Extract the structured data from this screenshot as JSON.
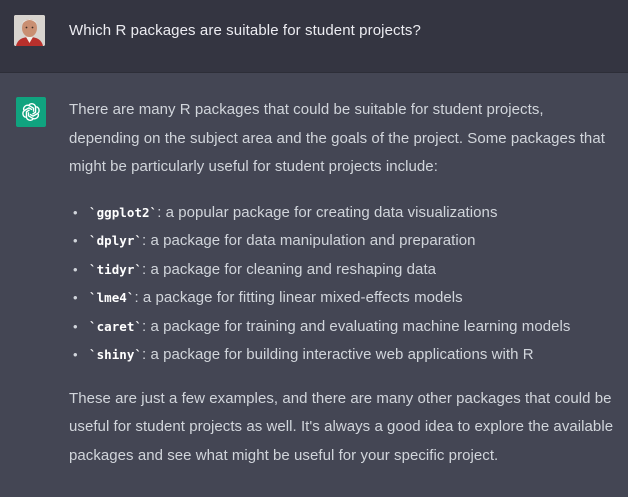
{
  "user_message": {
    "text": "Which R packages are suitable for student projects?"
  },
  "assistant_message": {
    "intro": "There are many R packages that could be suitable for student projects, depending on the subject area and the goals of the project. Some packages that might be particularly useful for student projects include:",
    "packages": [
      {
        "bullet": "•",
        "name": "`ggplot2`",
        "description": ": a popular package for creating data visualizations"
      },
      {
        "bullet": "•",
        "name": "`dplyr`",
        "description": ": a package for data manipulation and preparation"
      },
      {
        "bullet": "•",
        "name": "`tidyr`",
        "description": ": a package for cleaning and reshaping data"
      },
      {
        "bullet": "•",
        "name": "`lme4`",
        "description": ": a package for fitting linear mixed-effects models"
      },
      {
        "bullet": "•",
        "name": "`caret`",
        "description": ": a package for training and evaluating machine learning models"
      },
      {
        "bullet": "•",
        "name": "`shiny`",
        "description": ": a package for building interactive web applications with R"
      }
    ],
    "outro": "These are just a few examples, and there are many other packages that could be useful for student projects as well. It's always a good idea to explore the available packages and see what might be useful for your specific project."
  },
  "icons": {
    "user_avatar": "user-avatar",
    "assistant_avatar": "openai-logo-icon"
  },
  "colors": {
    "user_bg": "#343541",
    "assistant_bg": "#444654",
    "brand_green": "#10a37f",
    "text": "#d1d5db"
  }
}
